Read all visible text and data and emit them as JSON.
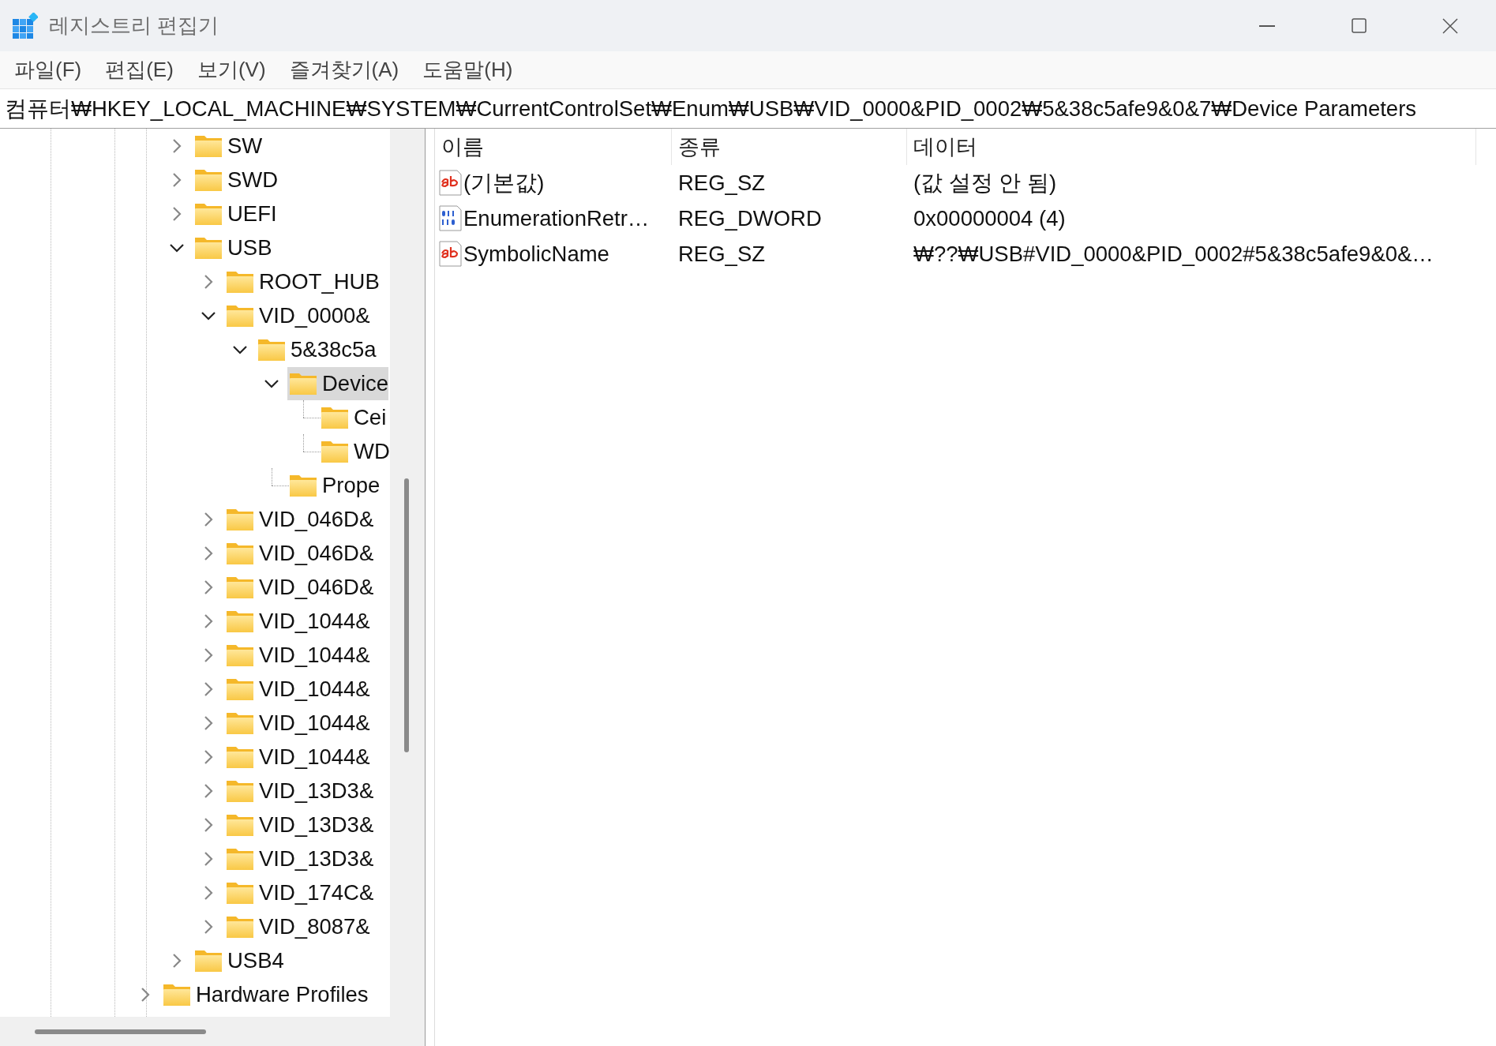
{
  "window": {
    "title": "레지스트리 편집기"
  },
  "menu": [
    "파일(F)",
    "편집(E)",
    "보기(V)",
    "즐겨찾기(A)",
    "도움말(H)"
  ],
  "address": "컴퓨터₩HKEY_LOCAL_MACHINE₩SYSTEM₩CurrentControlSet₩Enum₩USB₩VID_0000&PID_0002₩5&38c5afe9&0&7₩Device Parameters",
  "tree": {
    "nodes": [
      {
        "label": "SW",
        "expandable": true,
        "expanded": false,
        "selected": false
      },
      {
        "label": "SWD",
        "expandable": true,
        "expanded": false,
        "selected": false
      },
      {
        "label": "UEFI",
        "expandable": true,
        "expanded": false,
        "selected": false
      },
      {
        "label": "USB",
        "expandable": true,
        "expanded": true,
        "selected": false,
        "children": [
          {
            "label": "ROOT_HUB",
            "expandable": true,
            "expanded": false,
            "selected": false
          },
          {
            "label": "VID_0000&",
            "expandable": true,
            "expanded": true,
            "selected": false,
            "children": [
              {
                "label": "5&38c5a",
                "expandable": true,
                "expanded": true,
                "selected": false,
                "children": [
                  {
                    "label": "Device",
                    "expandable": true,
                    "expanded": true,
                    "selected": true,
                    "children": [
                      {
                        "label": "Cei",
                        "expandable": false,
                        "expanded": false,
                        "selected": false
                      },
                      {
                        "label": "WD",
                        "expandable": false,
                        "expanded": false,
                        "selected": false
                      }
                    ]
                  },
                  {
                    "label": "Prope",
                    "expandable": false,
                    "expanded": false,
                    "selected": false
                  }
                ]
              }
            ]
          },
          {
            "label": "VID_046D&",
            "expandable": true,
            "expanded": false,
            "selected": false
          },
          {
            "label": "VID_046D&",
            "expandable": true,
            "expanded": false,
            "selected": false
          },
          {
            "label": "VID_046D&",
            "expandable": true,
            "expanded": false,
            "selected": false
          },
          {
            "label": "VID_1044&",
            "expandable": true,
            "expanded": false,
            "selected": false
          },
          {
            "label": "VID_1044&",
            "expandable": true,
            "expanded": false,
            "selected": false
          },
          {
            "label": "VID_1044&",
            "expandable": true,
            "expanded": false,
            "selected": false
          },
          {
            "label": "VID_1044&",
            "expandable": true,
            "expanded": false,
            "selected": false
          },
          {
            "label": "VID_1044&",
            "expandable": true,
            "expanded": false,
            "selected": false
          },
          {
            "label": "VID_13D3&",
            "expandable": true,
            "expanded": false,
            "selected": false
          },
          {
            "label": "VID_13D3&",
            "expandable": true,
            "expanded": false,
            "selected": false
          },
          {
            "label": "VID_13D3&",
            "expandable": true,
            "expanded": false,
            "selected": false
          },
          {
            "label": "VID_174C&",
            "expandable": true,
            "expanded": false,
            "selected": false
          },
          {
            "label": "VID_8087&",
            "expandable": true,
            "expanded": false,
            "selected": false
          }
        ]
      },
      {
        "label": "USB4",
        "expandable": true,
        "expanded": false,
        "selected": false
      }
    ],
    "parent_level_nodes": [
      {
        "label": "Hardware Profiles",
        "expandable": true,
        "expanded": false,
        "selected": false
      }
    ]
  },
  "values": {
    "columns": [
      "이름",
      "종류",
      "데이터"
    ],
    "rows": [
      {
        "kind": "string",
        "name": "(기본값)",
        "type": "REG_SZ",
        "data": "(값 설정 안 됨)",
        "selected": false
      },
      {
        "kind": "binary",
        "name": "EnumerationRetr…",
        "type": "REG_DWORD",
        "data": "0x00000004 (4)",
        "selected": false
      },
      {
        "kind": "string",
        "name": "SymbolicName",
        "type": "REG_SZ",
        "data": "₩??₩USB#VID_0000&PID_0002#5&38c5afe9&0&…",
        "selected": false
      }
    ]
  }
}
